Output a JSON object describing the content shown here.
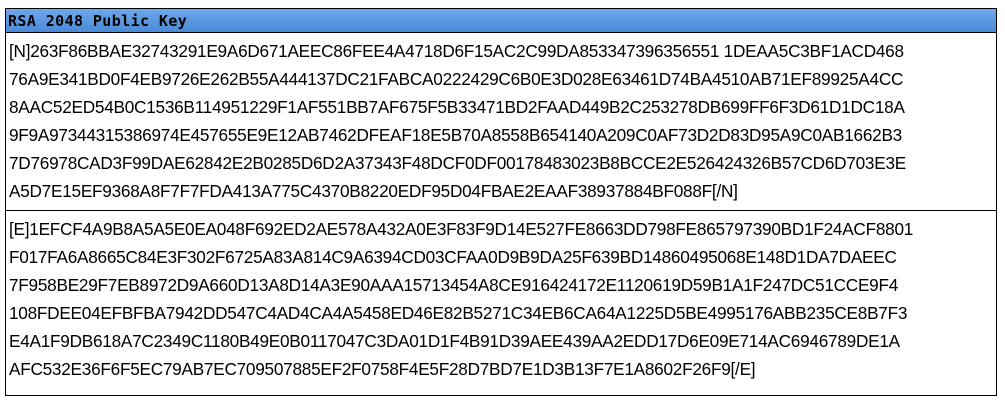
{
  "header": {
    "title": "RSA 2048 Public Key"
  },
  "modulus": {
    "lines": [
      "[N]263F86BBAE32743291E9A6D671AEEC86FEE4A4718D6F15AC2C99DA853347396356551 1DEAA5C3BF1ACD468",
      "76A9E341BD0F4EB9726E262B55A444137DC21FABCA0222429C6B0E3D028E63461D74BA4510AB71EF89925A4CC",
      "8AAC52ED54B0C1536B114951229F1AF551BB7AF675F5B33471BD2FAAD449B2C253278DB699FF6F3D61D1DC18A",
      "9F9A97344315386974E457655E9E12AB7462DFEAF18E5B70A8558B654140A209C0AF73D2D83D95A9C0AB1662B3",
      "7D76978CAD3F99DAE62842E2B0285D6D2A37343F48DCF0DF00178483023B8BCCE2E526424326B57CD6D703E3E",
      "A5D7E15EF9368A8F7F7FDA413A775C4370B8220EDF95D04FBAE2EAAF38937884BF088F[/N]"
    ]
  },
  "exponent": {
    "lines": [
      "[E]1EFCF4A9B8A5A5E0EA048F692ED2AE578A432A0E3F83F9D14E527FE8663DD798FE865797390BD1F24ACF8801",
      "F017FA6A8665C84E3F302F6725A83A814C9A6394CD03CFAA0D9B9DA25F639BD14860495068E148D1DA7DAEEC",
      "7F958BE29F7EB8972D9A660D13A8D14A3E90AAA15713454A8CE916424172E1120619D59B1A1F247DC51CCE9F4",
      "108FDEE04EFBFBA7942DD547C4AD4CA4A5458ED46E82B5271C34EB6CA64A1225D5BE4995176ABB235CE8B7F3",
      "E4A1F9DB618A7C2349C1180B49E0B0117047C3DA01D1F4B91D39AEE439AA2EDD17D6E09E714AC6946789DE1A",
      "AFC532E36F6F5EC79AB7EC709507885EF2F0758F4E5F28D7BD7E1D3B13F7E1A8602F26F9[/E]"
    ]
  }
}
